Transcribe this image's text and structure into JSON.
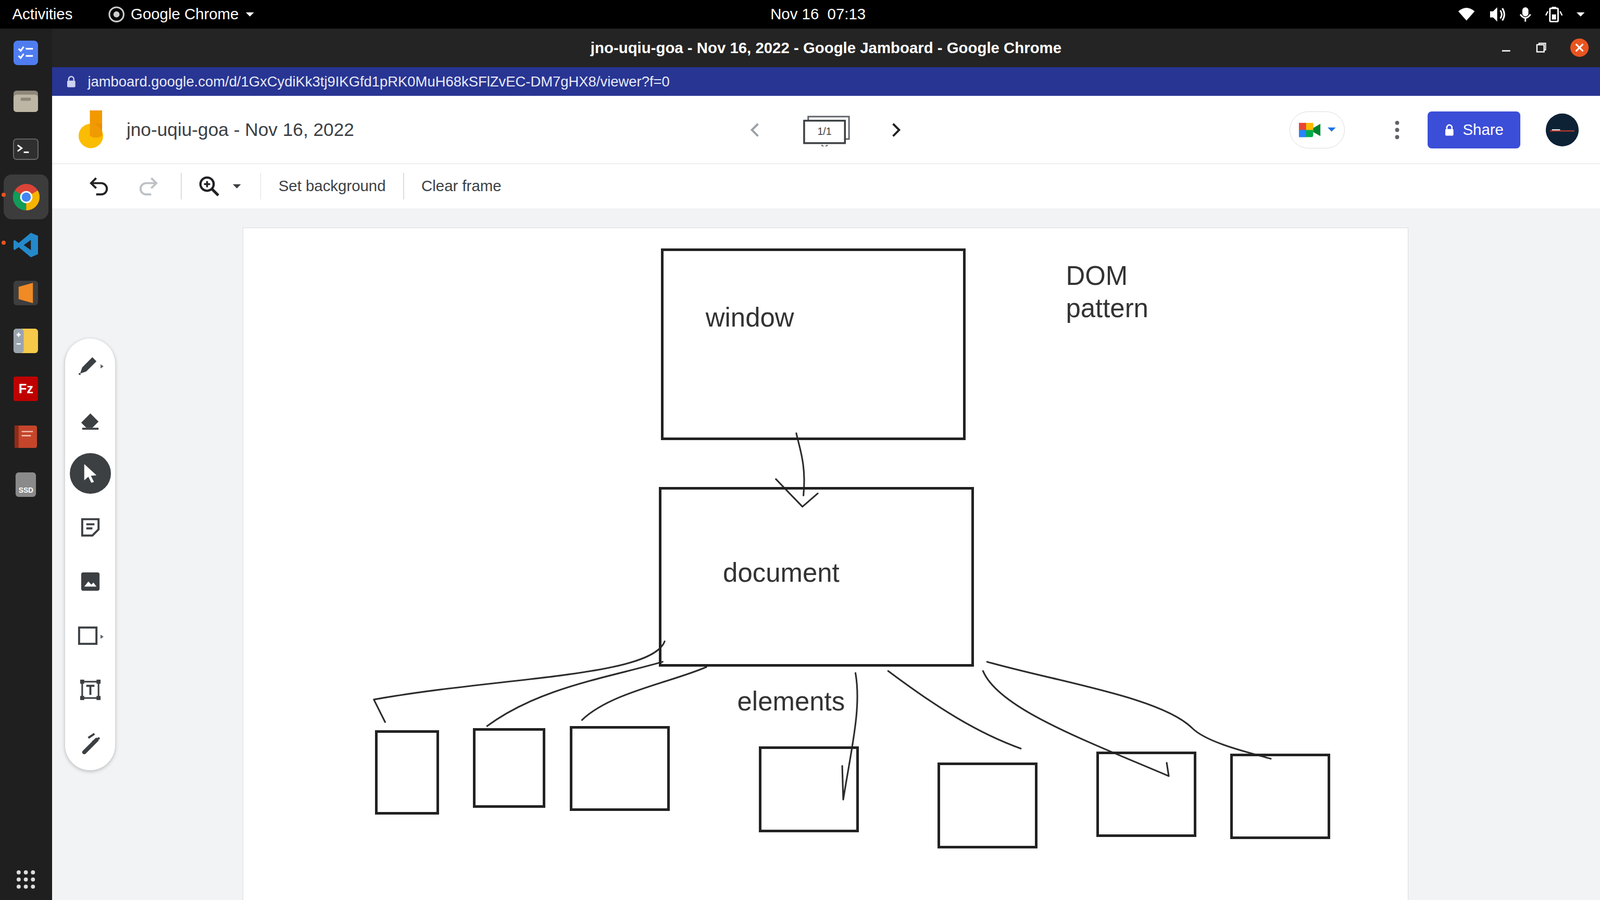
{
  "topbar": {
    "activities": "Activities",
    "app": "Google Chrome",
    "clock": "Nov 16  07:13"
  },
  "dock": [
    {
      "kind": "todo",
      "running": false,
      "selected": false
    },
    {
      "kind": "files",
      "running": false,
      "selected": false
    },
    {
      "kind": "terminal",
      "running": false,
      "selected": false
    },
    {
      "kind": "chrome",
      "running": true,
      "selected": true
    },
    {
      "kind": "vscode",
      "running": true,
      "selected": false
    },
    {
      "kind": "sublime",
      "running": false,
      "selected": false
    },
    {
      "kind": "office",
      "running": false,
      "selected": false
    },
    {
      "kind": "filezilla",
      "running": false,
      "selected": false,
      "label": "Fz"
    },
    {
      "kind": "book",
      "running": false,
      "selected": false
    },
    {
      "kind": "drive",
      "running": false,
      "selected": false,
      "label": "SSD"
    }
  ],
  "window": {
    "title": "jno-uqiu-goa - Nov 16, 2022 - Google Jamboard - Google Chrome"
  },
  "address": {
    "url": "jamboard.google.com/d/1GxCydiKk3tj9IKGfd1pRK0MuH68kSFlZvEC-DM7gHX8/viewer?f=0"
  },
  "jam": {
    "title": "jno-uqiu-goa - Nov 16, 2022",
    "frame": "1/1",
    "share": "Share"
  },
  "toolbar": {
    "items": [
      "Set background",
      "Clear frame"
    ]
  },
  "tools": [
    {
      "kind": "pen",
      "selected": false
    },
    {
      "kind": "eraser",
      "selected": false
    },
    {
      "kind": "select",
      "selected": true
    },
    {
      "kind": "sticky",
      "selected": false
    },
    {
      "kind": "image",
      "selected": false
    },
    {
      "kind": "shape",
      "selected": false
    },
    {
      "kind": "textbox",
      "selected": false
    },
    {
      "kind": "laser",
      "selected": false
    }
  ],
  "canvas": {
    "labels": [
      {
        "text": "window"
      },
      {
        "text": "document"
      },
      {
        "text": "elements"
      },
      {
        "text": "DOM\npattern"
      }
    ]
  }
}
